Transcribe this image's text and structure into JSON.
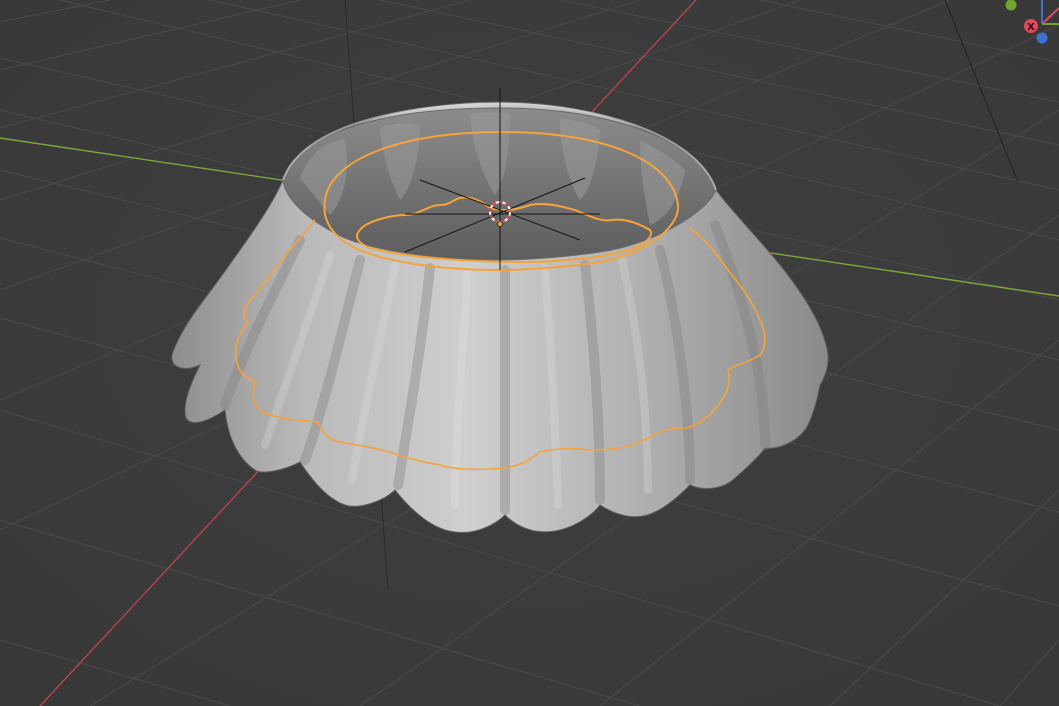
{
  "viewport": {
    "background_color": "#3d3d3d",
    "grid_color": "#4a4a4a",
    "x_axis_color": "#b5434f",
    "y_axis_color": "#7aa83a",
    "selection_outline_color": "#f5a33a",
    "mesh_base_color": "#a9a9a9"
  },
  "gizmo": {
    "x_label": "X",
    "x_color": "#e04a5a",
    "y_color": "#6fa52f",
    "z_color": "#3f6fd1"
  },
  "icons": {
    "origin": "object-origin-icon",
    "cursor": "3d-cursor-icon"
  }
}
